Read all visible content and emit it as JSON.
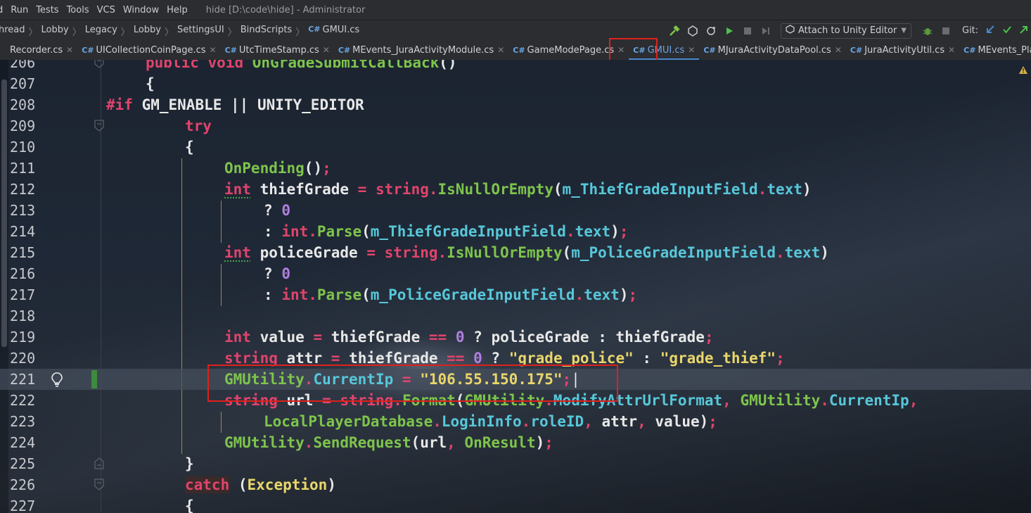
{
  "window_title": "hide [D:\\code\\hide] - Administrator",
  "menu": [
    "d",
    "Run",
    "Tests",
    "Tools",
    "VCS",
    "Window",
    "Help"
  ],
  "breadcrumb": [
    "hread",
    "Lobby",
    "Legacy",
    "Lobby",
    "SettingsUI",
    "BindScripts",
    "GMUI.cs"
  ],
  "breadcrumb_lang": "C#",
  "toolbar": {
    "attach_label": "Attach to Unity Editor",
    "git_label": "Git:"
  },
  "tabs": [
    {
      "label": "Recorder.cs",
      "lang": ""
    },
    {
      "label": "UICollectionCoinPage.cs",
      "lang": "C#"
    },
    {
      "label": "UtcTimeStamp.cs",
      "lang": "C#"
    },
    {
      "label": "MEvents_JuraActivityModule.cs",
      "lang": "C#"
    },
    {
      "label": "GameModePage.cs",
      "lang": "C#"
    },
    {
      "label": "GMUI.cs",
      "lang": "C#",
      "active": true
    },
    {
      "label": "MJuraActivityDataPool.cs",
      "lang": "C#"
    },
    {
      "label": "JuraActivityUtil.cs",
      "lang": "C#"
    },
    {
      "label": "MEvents_PlayerAssetsM",
      "lang": "C#"
    }
  ],
  "editor": {
    "current_line": 221,
    "lines": [
      {
        "n": "206",
        "text": "public void OnGradeSubmitCallBack()"
      },
      {
        "n": "207",
        "text": "{"
      },
      {
        "n": "208",
        "text": "#if GM_ENABLE || UNITY_EDITOR"
      },
      {
        "n": "209",
        "text": "try"
      },
      {
        "n": "210",
        "text": "{"
      },
      {
        "n": "211",
        "text": "OnPending();"
      },
      {
        "n": "212",
        "text": "int thiefGrade = string.IsNullOrEmpty(m_ThiefGradeInputField.text)"
      },
      {
        "n": "213",
        "text": "? 0"
      },
      {
        "n": "214",
        "text": ": int.Parse(m_ThiefGradeInputField.text);"
      },
      {
        "n": "215",
        "text": "int policeGrade = string.IsNullOrEmpty(m_PoliceGradeInputField.text)"
      },
      {
        "n": "216",
        "text": "? 0"
      },
      {
        "n": "217",
        "text": ": int.Parse(m_PoliceGradeInputField.text);"
      },
      {
        "n": "218",
        "text": ""
      },
      {
        "n": "219",
        "text": "int value = thiefGrade == 0 ? policeGrade : thiefGrade;"
      },
      {
        "n": "220",
        "text": "string attr = thiefGrade == 0 ? \"grade_police\" : \"grade_thief\";"
      },
      {
        "n": "221",
        "text": "GMUtility.CurrentIp = \"106.55.150.175\";"
      },
      {
        "n": "222",
        "text": "string url = string.Format(GMUtility.ModifyAttrUrlFormat, GMUtility.CurrentIp,"
      },
      {
        "n": "223",
        "text": "LocalPlayerDatabase.LoginInfo.roleID, attr, value);"
      },
      {
        "n": "224",
        "text": "GMUtility.SendRequest(url, OnResult);"
      },
      {
        "n": "225",
        "text": "}"
      },
      {
        "n": "226",
        "text": "catch (Exception)"
      },
      {
        "n": "227",
        "text": "{"
      }
    ],
    "tokens": {
      "public": "public",
      "void": "void",
      "method_206": "OnGradeSubmitCallBack",
      "hash_if": "#if",
      "cond": "GM_ENABLE || UNITY_EDITOR",
      "try": "try",
      "catch": "catch",
      "exception": "Exception",
      "on_pending": "OnPending",
      "int": "int",
      "string": "string",
      "q": "?",
      "colon": ":",
      "eq": "=",
      "eqeq": "==",
      "zero": "0",
      "thief_grade": "thiefGrade",
      "police_grade": "policeGrade",
      "is_null_or_empty": "IsNullOrEmpty",
      "parse": "Parse",
      "thief_field": "m_ThiefGradeInputField",
      "police_field": "m_PoliceGradeInputField",
      "text": "text",
      "value": "value",
      "attr": "attr",
      "str_police": "\"grade_police\"",
      "str_thief": "\"grade_thief\"",
      "gmutility": "GMUtility",
      "current_ip": "CurrentIp",
      "ip_str": "\"106.55.150.175\"",
      "url": "url",
      "format": "Format",
      "modify_fmt": "ModifyAttrUrlFormat",
      "local_db": "LocalPlayerDatabase",
      "login_info": "LoginInfo",
      "role_id": "roleID",
      "send_request": "SendRequest",
      "on_result": "OnResult"
    }
  }
}
